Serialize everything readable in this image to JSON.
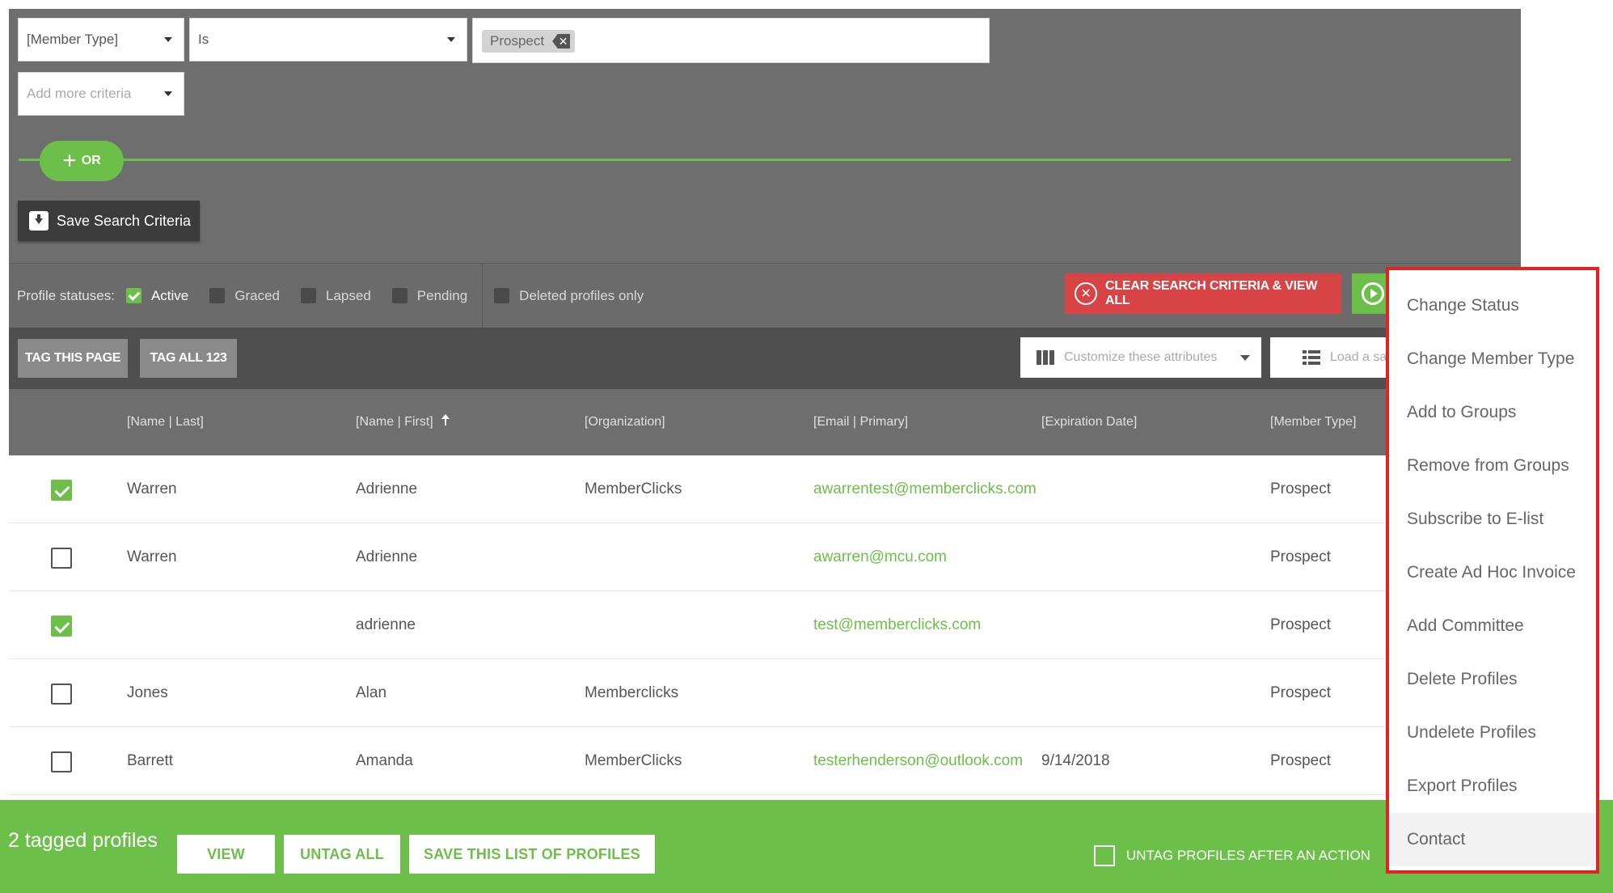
{
  "criteria": {
    "field_select": "[Member Type]",
    "operator_select": "Is",
    "value_chip": "Prospect",
    "add_more_placeholder": "Add more criteria",
    "or_label": "OR",
    "save_label": "Save Search Criteria"
  },
  "statuses": {
    "label": "Profile statuses:",
    "items": [
      {
        "label": "Active",
        "checked": true
      },
      {
        "label": "Graced",
        "checked": false
      },
      {
        "label": "Lapsed",
        "checked": false
      },
      {
        "label": "Pending",
        "checked": false
      }
    ],
    "deleted_only": "Deleted profiles only",
    "clear_label": "CLEAR SEARCH CRITERIA & VIEW ALL"
  },
  "tagbar": {
    "tag_page": "TAG THIS PAGE",
    "tag_all": "TAG ALL 123",
    "customize": "Customize these attributes",
    "load_saved": "Load a sa"
  },
  "table": {
    "columns": [
      "[Name | Last]",
      "[Name | First]",
      "[Organization]",
      "[Email | Primary]",
      "[Expiration Date]",
      "[Member Type]"
    ],
    "rows": [
      {
        "checked": true,
        "last": "Warren",
        "first": "Adrienne",
        "org": "MemberClicks",
        "email": "awarrentest@memberclicks.com",
        "exp": "",
        "type": "Prospect"
      },
      {
        "checked": false,
        "last": "Warren",
        "first": "Adrienne",
        "org": "",
        "email": "awarren@mcu.com",
        "exp": "",
        "type": "Prospect"
      },
      {
        "checked": true,
        "last": "",
        "first": "adrienne",
        "org": "",
        "email": "test@memberclicks.com",
        "exp": "",
        "type": "Prospect"
      },
      {
        "checked": false,
        "last": "Jones",
        "first": "Alan",
        "org": "Memberclicks",
        "email": "",
        "exp": "",
        "type": "Prospect"
      },
      {
        "checked": false,
        "last": "Barrett",
        "first": "Amanda",
        "org": "MemberClicks",
        "email": "testerhenderson@outlook.com",
        "exp": "9/14/2018",
        "type": "Prospect"
      }
    ]
  },
  "footer": {
    "tagged": "2 tagged profiles",
    "view": "VIEW",
    "untag_all": "UNTAG ALL",
    "save_list": "SAVE THIS LIST OF PROFILES",
    "untag_after": "UNTAG PROFILES AFTER AN ACTION"
  },
  "menu": {
    "items": [
      "Change Status",
      "Change Member Type",
      "Add to Groups",
      "Remove from Groups",
      "Subscribe to E-list",
      "Create Ad Hoc Invoice",
      "Add Committee",
      "Delete Profiles",
      "Undelete Profiles",
      "Export Profiles",
      "Contact"
    ]
  },
  "colors": {
    "accent_green": "#6cc04a",
    "danger_red": "#d84345",
    "panel_gray": "#6e6e6e",
    "highlight_border": "#e02424"
  }
}
